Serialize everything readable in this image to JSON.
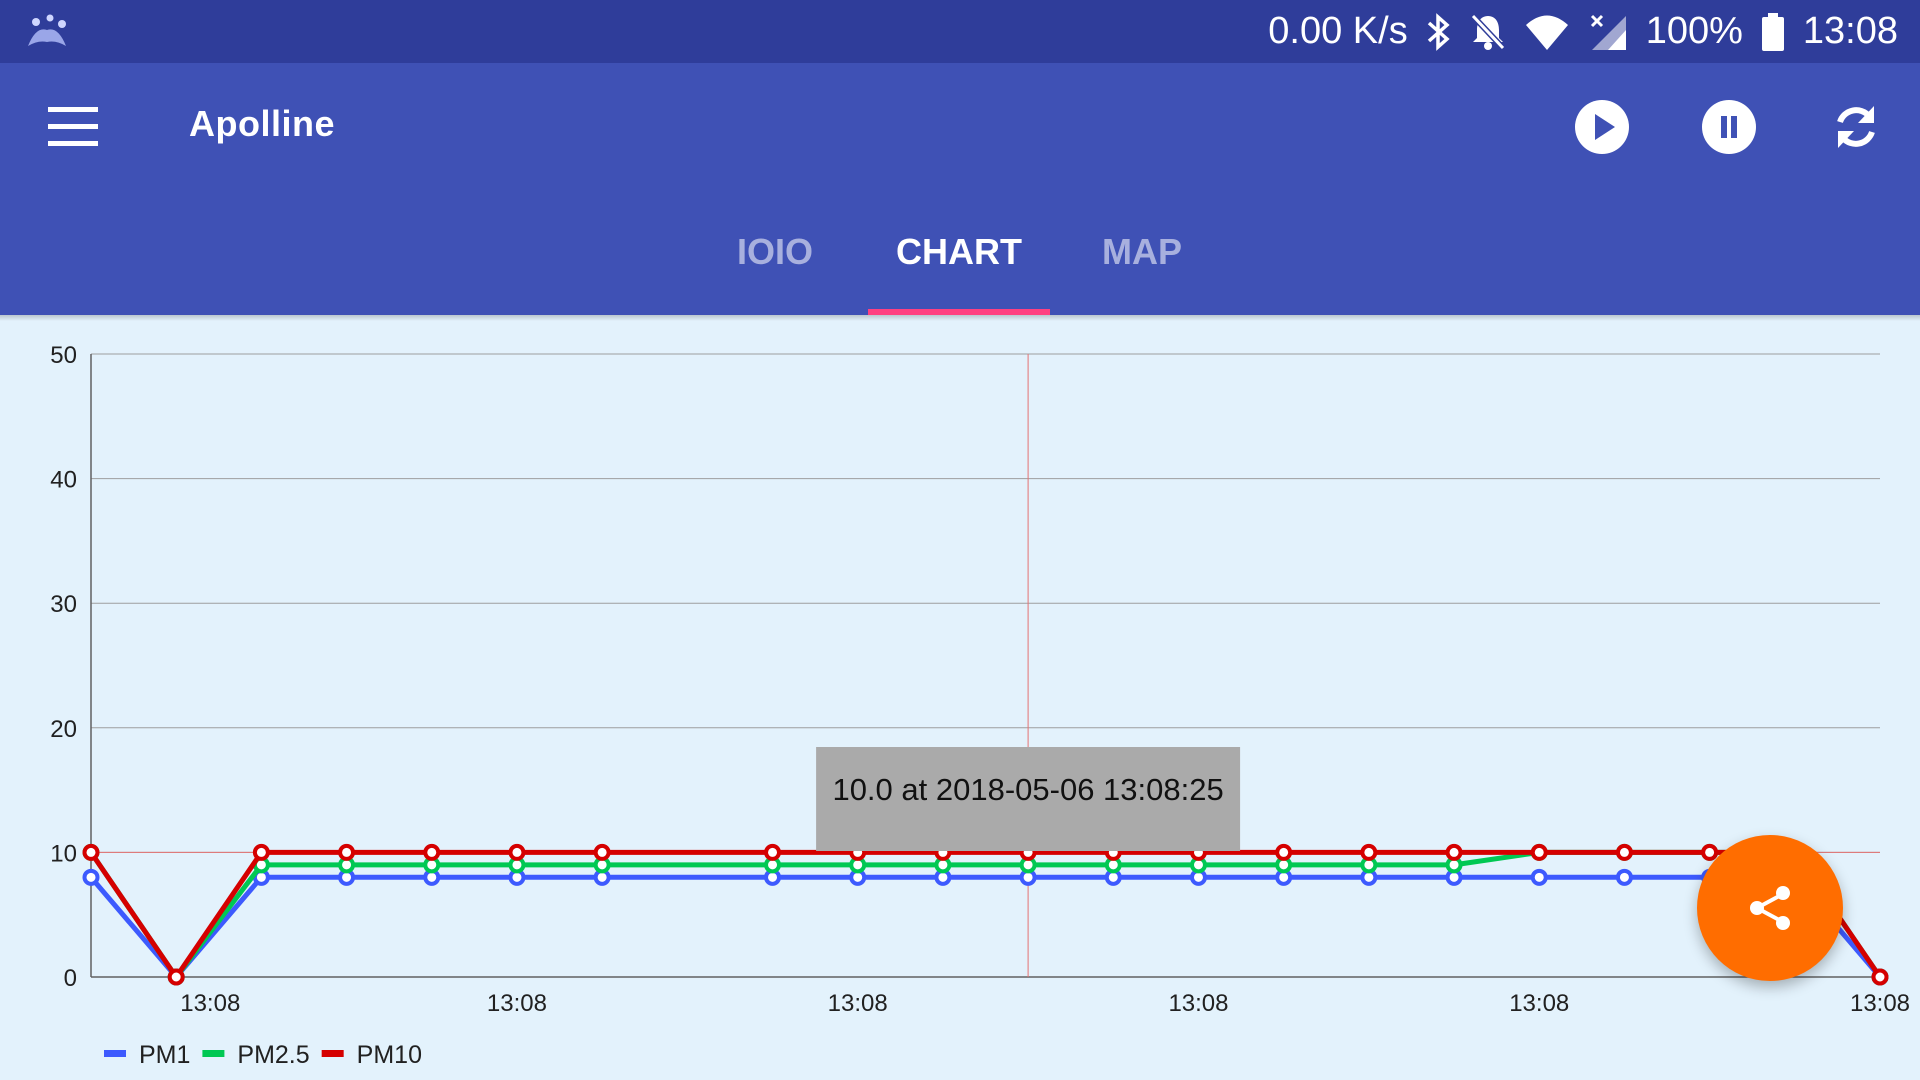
{
  "status_bar": {
    "net_speed": "0.00 K/s",
    "battery": "100%",
    "time": "13:08",
    "icons": [
      "app-notification-icon",
      "bluetooth-icon",
      "notifications-off-icon",
      "wifi-icon",
      "no-signal-icon",
      "battery-full-icon"
    ]
  },
  "toolbar": {
    "title": "Apolline",
    "icons": [
      "menu-icon",
      "play-icon",
      "pause-icon",
      "sync-icon"
    ]
  },
  "tabs": [
    {
      "label": "IOIO",
      "active": false
    },
    {
      "label": "CHART",
      "active": true
    },
    {
      "label": "MAP",
      "active": false
    }
  ],
  "colors": {
    "status_bar": "#2f3d9a",
    "app_bar": "#3f51b5",
    "tab_indicator": "#ff4081",
    "chart_background": "#e3f2fc",
    "fab": "#ff6d00",
    "highlight": "#e57373"
  },
  "fab": {
    "icon": "share-icon"
  },
  "chart_data": {
    "type": "line",
    "grid": true,
    "legend_position": "bottom-left",
    "ylim": [
      0,
      50
    ],
    "y_ticks": [
      "0",
      "10",
      "20",
      "30",
      "40",
      "50"
    ],
    "x_tick_labels": [
      "13:08",
      "13:08",
      "13:08",
      "13:08",
      "13:08",
      "13:08"
    ],
    "x_tick_index": [
      1.4,
      5.0,
      9.0,
      13.0,
      17.0,
      21.0
    ],
    "x": [
      0,
      1,
      2,
      3,
      4,
      5,
      6,
      8,
      9,
      10,
      11,
      12,
      13,
      14,
      15,
      16,
      17,
      18,
      19,
      20,
      21
    ],
    "series": [
      {
        "name": "PM1",
        "color": "#3d5afe",
        "values": [
          8,
          0,
          8,
          8,
          8,
          8,
          8,
          8,
          8,
          8,
          8,
          8,
          8,
          8,
          8,
          8,
          8,
          8,
          8,
          8,
          0
        ]
      },
      {
        "name": "PM2.5",
        "color": "#00c853",
        "values": [
          10,
          0,
          9,
          9,
          9,
          9,
          9,
          9,
          9,
          9,
          9,
          9,
          9,
          9,
          9,
          9,
          10,
          10,
          10,
          10,
          0
        ]
      },
      {
        "name": "PM10",
        "color": "#d50000",
        "values": [
          10,
          0,
          10,
          10,
          10,
          10,
          10,
          10,
          10,
          10,
          10,
          10,
          10,
          10,
          10,
          10,
          10,
          10,
          10,
          10,
          0
        ]
      }
    ],
    "highlight": {
      "x": 11,
      "y": 10
    },
    "tooltip": "10.0 at 2018-05-06 13:08:25"
  }
}
